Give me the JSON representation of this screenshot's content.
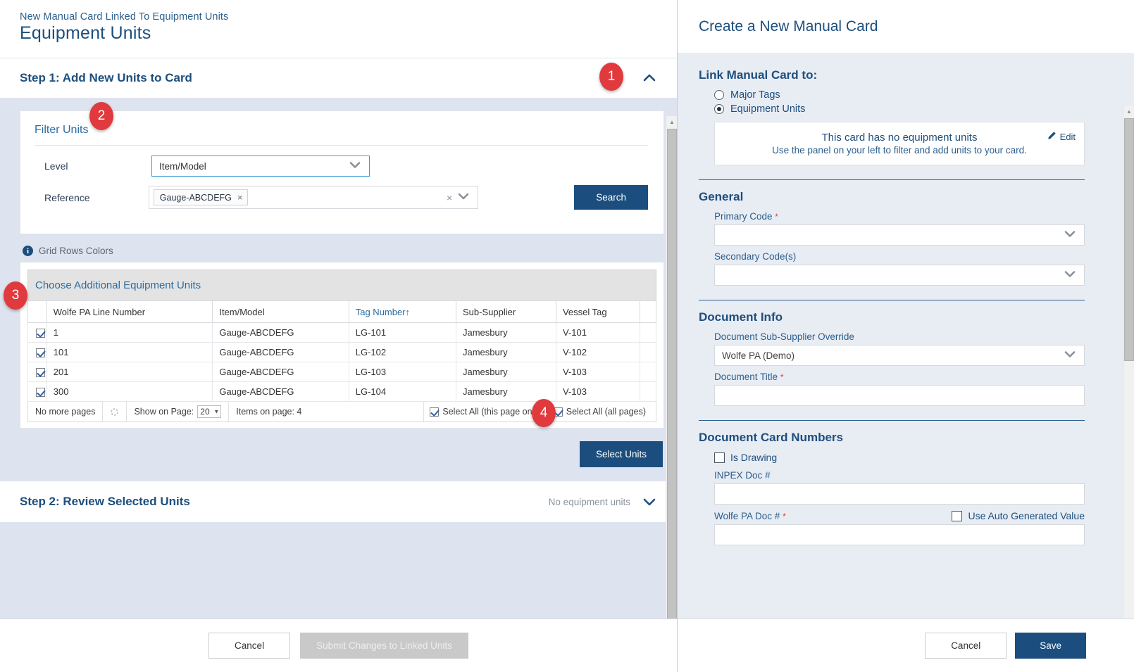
{
  "left": {
    "breadcrumb": "New Manual Card Linked To Equipment Units",
    "page_title": "Equipment Units",
    "step1": {
      "title": "Step 1: Add New Units to Card",
      "collapse_icon": "chevron-up-icon",
      "badge": "1"
    },
    "filter": {
      "title": "Filter Units",
      "badge": "2",
      "level_label": "Level",
      "level_value": "Item/Model",
      "reference_label": "Reference",
      "reference_token": "Gauge-ABCDEFG",
      "token_remove": "×",
      "clear_all": "×",
      "search_button": "Search"
    },
    "grid_rows_colors": "Grid Rows Colors",
    "grid": {
      "caption": "Choose Additional Equipment Units",
      "badge": "3",
      "columns": [
        "",
        "Wolfe PA Line Number",
        "Item/Model",
        "Tag Number↑",
        "Sub-Supplier",
        "Vessel Tag",
        ""
      ],
      "sorted_column": "Tag Number↑",
      "rows": [
        {
          "checked": true,
          "line": "1",
          "item": "Gauge-ABCDEFG",
          "tag": "LG-101",
          "sub": "Jamesbury",
          "vessel": "V-101"
        },
        {
          "checked": true,
          "line": "101",
          "item": "Gauge-ABCDEFG",
          "tag": "LG-102",
          "sub": "Jamesbury",
          "vessel": "V-102"
        },
        {
          "checked": true,
          "line": "201",
          "item": "Gauge-ABCDEFG",
          "tag": "LG-103",
          "sub": "Jamesbury",
          "vessel": "V-103"
        },
        {
          "checked": true,
          "line": "300",
          "item": "Gauge-ABCDEFG",
          "tag": "LG-104",
          "sub": "Jamesbury",
          "vessel": "V-103"
        }
      ],
      "footer": {
        "pages_status": "No more pages",
        "refresh_icon": "refresh-icon",
        "show_on_page_label": "Show on Page:",
        "show_on_page_value": "20",
        "items_on_page": "Items on page: 4",
        "select_all_page": "Select All (this page only)",
        "select_all_page_checked": true,
        "select_all_all": "Select All (all pages)",
        "select_all_all_checked": true
      }
    },
    "select_units_button": "Select Units",
    "select_units_badge": "4",
    "step2": {
      "title": "Step 2: Review Selected Units",
      "status": "No equipment units",
      "expand_icon": "chevron-down-icon"
    },
    "footer": {
      "cancel": "Cancel",
      "submit": "Submit Changes to Linked Units"
    }
  },
  "right": {
    "title": "Create a New Manual Card",
    "link_section": {
      "title": "Link Manual Card to:",
      "options": [
        {
          "label": "Major Tags",
          "selected": false
        },
        {
          "label": "Equipment Units",
          "selected": true
        }
      ],
      "empty_card_line1": "This card has no equipment units",
      "empty_card_line2": "Use the panel on your left to filter and add units to your card.",
      "edit_label": "Edit",
      "edit_icon": "pencil-icon"
    },
    "general": {
      "title": "General",
      "primary_code_label": "Primary Code",
      "primary_code_required": "*",
      "primary_code_value": "",
      "secondary_code_label": "Secondary Code(s)",
      "secondary_code_value": ""
    },
    "document_info": {
      "title": "Document Info",
      "sub_supplier_label": "Document Sub-Supplier Override",
      "sub_supplier_value": "Wolfe PA (Demo)",
      "doc_title_label": "Document Title",
      "doc_title_required": "*",
      "doc_title_value": ""
    },
    "document_card_numbers": {
      "title": "Document Card Numbers",
      "is_drawing_label": "Is Drawing",
      "is_drawing_checked": false,
      "inpex_label": "INPEX Doc #",
      "inpex_value": "",
      "wolfe_label": "Wolfe PA Doc #",
      "wolfe_required": "*",
      "wolfe_value": "",
      "auto_value_label": "Use Auto Generated Value",
      "auto_value_checked": false
    },
    "footer": {
      "cancel": "Cancel",
      "save": "Save"
    }
  },
  "colors": {
    "accent_dark_blue": "#1b4e7e",
    "link_blue": "#2b6ca3",
    "panel_bg": "#dde3ef",
    "right_panel_bg": "#e8ecf3",
    "badge_red": "#e03a3e",
    "required_red": "#e0393e"
  }
}
